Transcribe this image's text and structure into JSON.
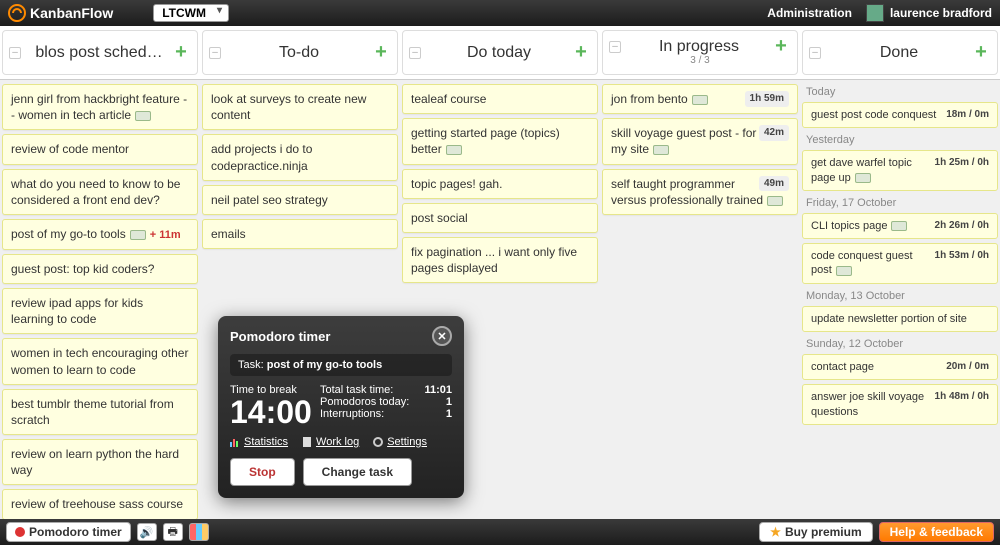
{
  "app": {
    "name": "KanbanFlow"
  },
  "header": {
    "board_select": "LTCWM",
    "admin": "Administration",
    "user": "laurence bradford"
  },
  "columns": [
    {
      "title": "blos post sched…",
      "cards": [
        {
          "text": "jenn girl from hackbright feature -- women in tech article",
          "icon": true
        },
        {
          "text": "review of code mentor"
        },
        {
          "text": "what do you need to know to be considered a front end dev?"
        },
        {
          "text": "post of my go-to tools",
          "icon": true,
          "red_time": "+ 11m"
        },
        {
          "text": "guest post: top kid coders?"
        },
        {
          "text": "review ipad apps for kids learning to code"
        },
        {
          "text": "women in tech encouraging other women to learn to code"
        },
        {
          "text": "best tumblr theme tutorial from scratch"
        },
        {
          "text": "review on learn python the hard way"
        },
        {
          "text": "review of treehouse sass course"
        }
      ]
    },
    {
      "title": "To-do",
      "cards": [
        {
          "text": "look at surveys to create new content"
        },
        {
          "text": "add projects i do to codepractice.ninja"
        },
        {
          "text": "neil patel seo strategy"
        },
        {
          "text": "emails"
        }
      ]
    },
    {
      "title": "Do today",
      "cards": [
        {
          "text": "tealeaf course"
        },
        {
          "text": "getting started page (topics) better",
          "icon": true
        },
        {
          "text": "topic pages! gah."
        },
        {
          "text": "post social"
        },
        {
          "text": "fix pagination ... i want only five pages displayed"
        }
      ]
    },
    {
      "title": "In progress",
      "subtitle": "3 / 3",
      "cards": [
        {
          "text": "jon from bento",
          "icon": true,
          "time_right": "1h 59m"
        },
        {
          "text": "skill voyage guest post - for my site",
          "icon": true,
          "time_right": "42m"
        },
        {
          "text": "self taught programmer versus professionally trained",
          "icon": true,
          "time_right": "49m"
        }
      ]
    },
    {
      "title": "Done",
      "groups": [
        {
          "label": "Today",
          "cards": [
            {
              "text": "guest post code conquest",
              "time": "18m / 0m"
            }
          ]
        },
        {
          "label": "Yesterday",
          "cards": [
            {
              "text": "get dave warfel topic page up",
              "icon": true,
              "time": "1h 25m / 0h"
            }
          ]
        },
        {
          "label": "Friday, 17 October",
          "cards": [
            {
              "text": "CLI topics page",
              "icon": true,
              "time": "2h 26m / 0h"
            },
            {
              "text": "code conquest guest post",
              "icon": true,
              "time": "1h 53m / 0h"
            }
          ]
        },
        {
          "label": "Monday, 13 October",
          "cards": [
            {
              "text": "update newsletter portion of site"
            }
          ]
        },
        {
          "label": "Sunday, 12 October",
          "cards": [
            {
              "text": "contact page",
              "time": "20m / 0m"
            },
            {
              "text": "answer joe skill voyage questions",
              "time": "1h 48m / 0h"
            }
          ]
        }
      ]
    }
  ],
  "pomodoro": {
    "title": "Pomodoro timer",
    "task_label": "Task:",
    "task_name": "post of my go-to tools",
    "time_to_break_label": "Time to break",
    "big_time": "14:00",
    "total_label": "Total task time:",
    "total_value": "11:01",
    "today_label": "Pomodoros today:",
    "today_value": "1",
    "intr_label": "Interruptions:",
    "intr_value": "1",
    "link_stats": "Statistics",
    "link_worklog": "Work log",
    "link_settings": "Settings",
    "btn_stop": "Stop",
    "btn_change": "Change task"
  },
  "bottombar": {
    "timer": "Pomodoro timer",
    "buy": "Buy premium",
    "help": "Help & feedback"
  }
}
